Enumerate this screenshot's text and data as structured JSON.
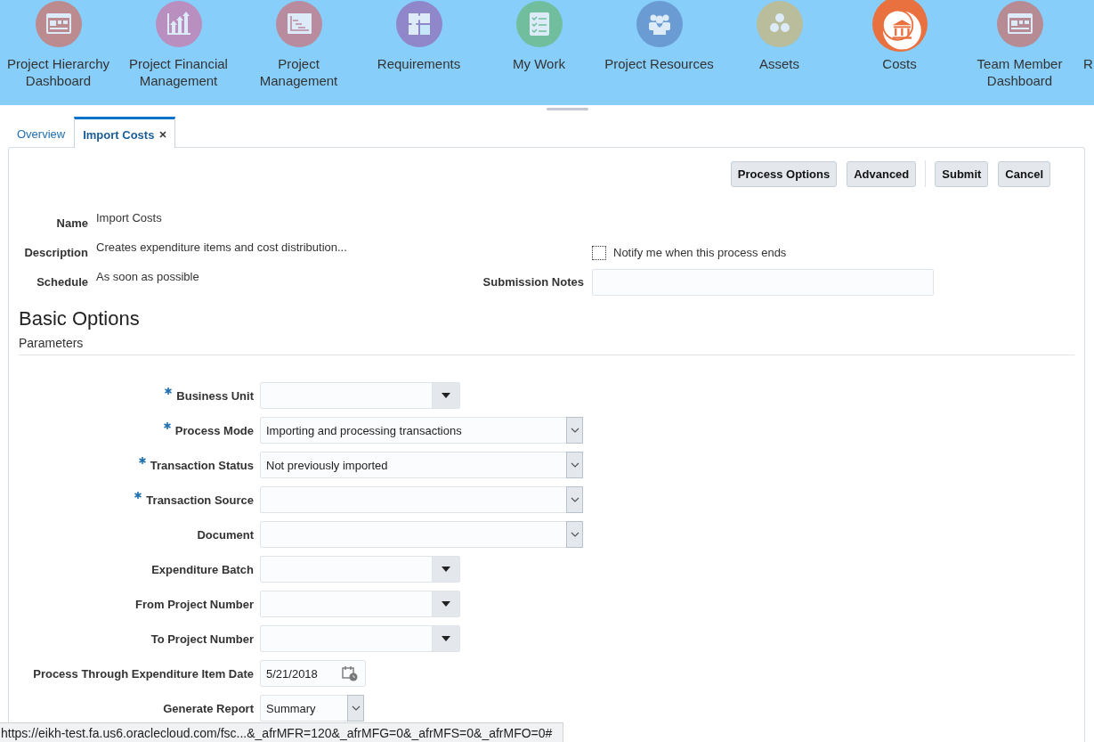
{
  "nav": {
    "items": [
      {
        "label": "Project Hierarchy Dashboard",
        "kind": "dashboard",
        "color": "#bb8b90",
        "selected": false
      },
      {
        "label": "Project Financial Management",
        "kind": "growth",
        "color": "#b98fbf",
        "selected": false
      },
      {
        "label": "Project Management",
        "kind": "schedule",
        "color": "#b98b9e",
        "selected": false
      },
      {
        "label": "Requirements",
        "kind": "puzzle",
        "color": "#8f87c9",
        "selected": false
      },
      {
        "label": "My Work",
        "kind": "checklist",
        "color": "#70be9e",
        "selected": false
      },
      {
        "label": "Project Resources",
        "kind": "people",
        "color": "#6a9bd3",
        "selected": false
      },
      {
        "label": "Assets",
        "kind": "dots",
        "color": "#b9bd9b",
        "selected": false
      },
      {
        "label": "Costs",
        "kind": "bank",
        "color": "#e8713f",
        "selected": true
      },
      {
        "label": "Team Member Dashboard",
        "kind": "dashboard",
        "color": "#b78b93",
        "selected": false
      },
      {
        "label": "R",
        "kind": "text"
      }
    ]
  },
  "tabs": [
    {
      "label": "Overview",
      "selected": false,
      "closable": false
    },
    {
      "label": "Import Costs",
      "selected": true,
      "closable": true
    }
  ],
  "toolbar": {
    "buttons": [
      {
        "label": "Process Options",
        "separator_before": false
      },
      {
        "label": "Advanced",
        "separator_before": false
      },
      {
        "label": "Submit",
        "separator_before": true
      },
      {
        "label": "Cancel",
        "separator_before": false
      }
    ]
  },
  "details": {
    "name_label": "Name",
    "name": "Import Costs",
    "description_label": "Description",
    "description": "Creates expenditure items and cost distribution...",
    "schedule_label": "Schedule",
    "schedule": "As soon as possible",
    "notify": {
      "label": "Notify me when this process ends",
      "checked": false
    },
    "notes_label": "Submission Notes"
  },
  "section": {
    "title": "Basic Options",
    "subtitle": "Parameters"
  },
  "parameters": [
    {
      "label": "Business Unit",
      "required": true,
      "kind": "lov"
    },
    {
      "label": "Process Mode",
      "required": true,
      "kind": "choice",
      "value": "Importing and processing transactions"
    },
    {
      "label": "Transaction Status",
      "required": true,
      "kind": "choice",
      "value": "Not previously imported"
    },
    {
      "label": "Transaction Source",
      "required": true,
      "kind": "choice"
    },
    {
      "label": "Document",
      "required": false,
      "kind": "choice"
    },
    {
      "label": "Expenditure Batch",
      "required": false,
      "kind": "lov"
    },
    {
      "label": "From Project Number",
      "required": false,
      "kind": "lov"
    },
    {
      "label": "To Project Number",
      "required": false,
      "kind": "lov"
    },
    {
      "label": "Process Through Expenditure Item Date",
      "required": false,
      "kind": "date",
      "value": "5/21/2018"
    },
    {
      "label": "Generate Report",
      "required": false,
      "kind": "short-choice",
      "value": "Summary"
    }
  ],
  "status_bar": {
    "url": "https://eikh-test.fa.us6.oraclecloud.com/fsc...&_afrMFR=120&_afrMFG=0&_afrMFS=0&_afrMFO=0#"
  }
}
